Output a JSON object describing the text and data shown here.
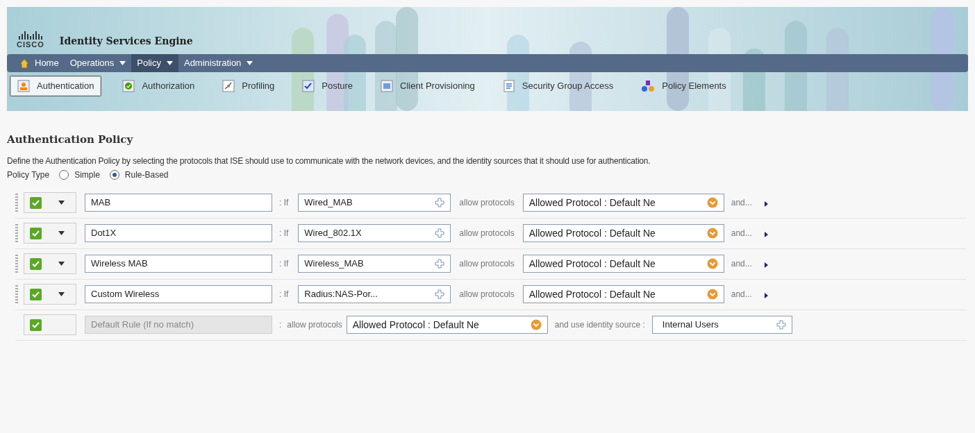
{
  "header": {
    "logo_text": "CISCO",
    "product": "Identity Services Engine"
  },
  "nav": [
    {
      "kind": "home",
      "label": "Home",
      "dropdown": false,
      "selected": false
    },
    {
      "kind": "menu",
      "label": "Operations",
      "dropdown": true,
      "selected": false
    },
    {
      "kind": "menu",
      "label": "Policy",
      "dropdown": true,
      "selected": true
    },
    {
      "kind": "menu",
      "label": "Administration",
      "dropdown": true,
      "selected": false
    }
  ],
  "subtabs": [
    {
      "label": "Authentication",
      "selected": true
    },
    {
      "label": "Authorization",
      "selected": false
    },
    {
      "label": "Profiling",
      "selected": false
    },
    {
      "label": "Posture",
      "selected": false
    },
    {
      "label": "Client Provisioning",
      "selected": false
    },
    {
      "label": "Security Group Access",
      "selected": false
    },
    {
      "label": "Policy Elements",
      "selected": false
    }
  ],
  "policy": {
    "title": "Authentication Policy",
    "description": "Define the Authentication Policy by selecting the protocols that ISE should use to communicate with the network devices, and the identity sources that it should use for authentication.",
    "type_label": "Policy Type",
    "options": [
      {
        "label": "Simple",
        "selected": false
      },
      {
        "label": "Rule-Based",
        "selected": true
      }
    ]
  },
  "rules": [
    {
      "kind": "rule",
      "enabled": true,
      "name": "MAB",
      "if_label": ": If",
      "condition": "Wired_MAB",
      "allow_label": "allow protocols",
      "protocol": "Allowed Protocol : Default Ne",
      "and_label": "and..."
    },
    {
      "kind": "rule",
      "enabled": true,
      "name": "Dot1X",
      "if_label": ": If",
      "condition": "Wired_802.1X",
      "allow_label": "allow protocols",
      "protocol": "Allowed Protocol : Default Ne",
      "and_label": "and..."
    },
    {
      "kind": "rule",
      "enabled": true,
      "name": "Wireless MAB",
      "if_label": ": If",
      "condition": "Wireless_MAB",
      "allow_label": "allow protocols",
      "protocol": "Allowed Protocol : Default Ne",
      "and_label": "and..."
    },
    {
      "kind": "rule",
      "enabled": true,
      "name": "Custom Wireless",
      "if_label": ": If",
      "condition": "Radius:NAS-Por...",
      "allow_label": "allow protocols",
      "protocol": "Allowed Protocol : Default Ne",
      "and_label": "and..."
    },
    {
      "kind": "default",
      "enabled": true,
      "name": "Default Rule (If no match)",
      "separator": ":",
      "allow_label": "allow protocols",
      "protocol": "Allowed Protocol : Default Ne",
      "identity_label": "and use identity source :",
      "identity_source": "Internal Users"
    }
  ]
}
